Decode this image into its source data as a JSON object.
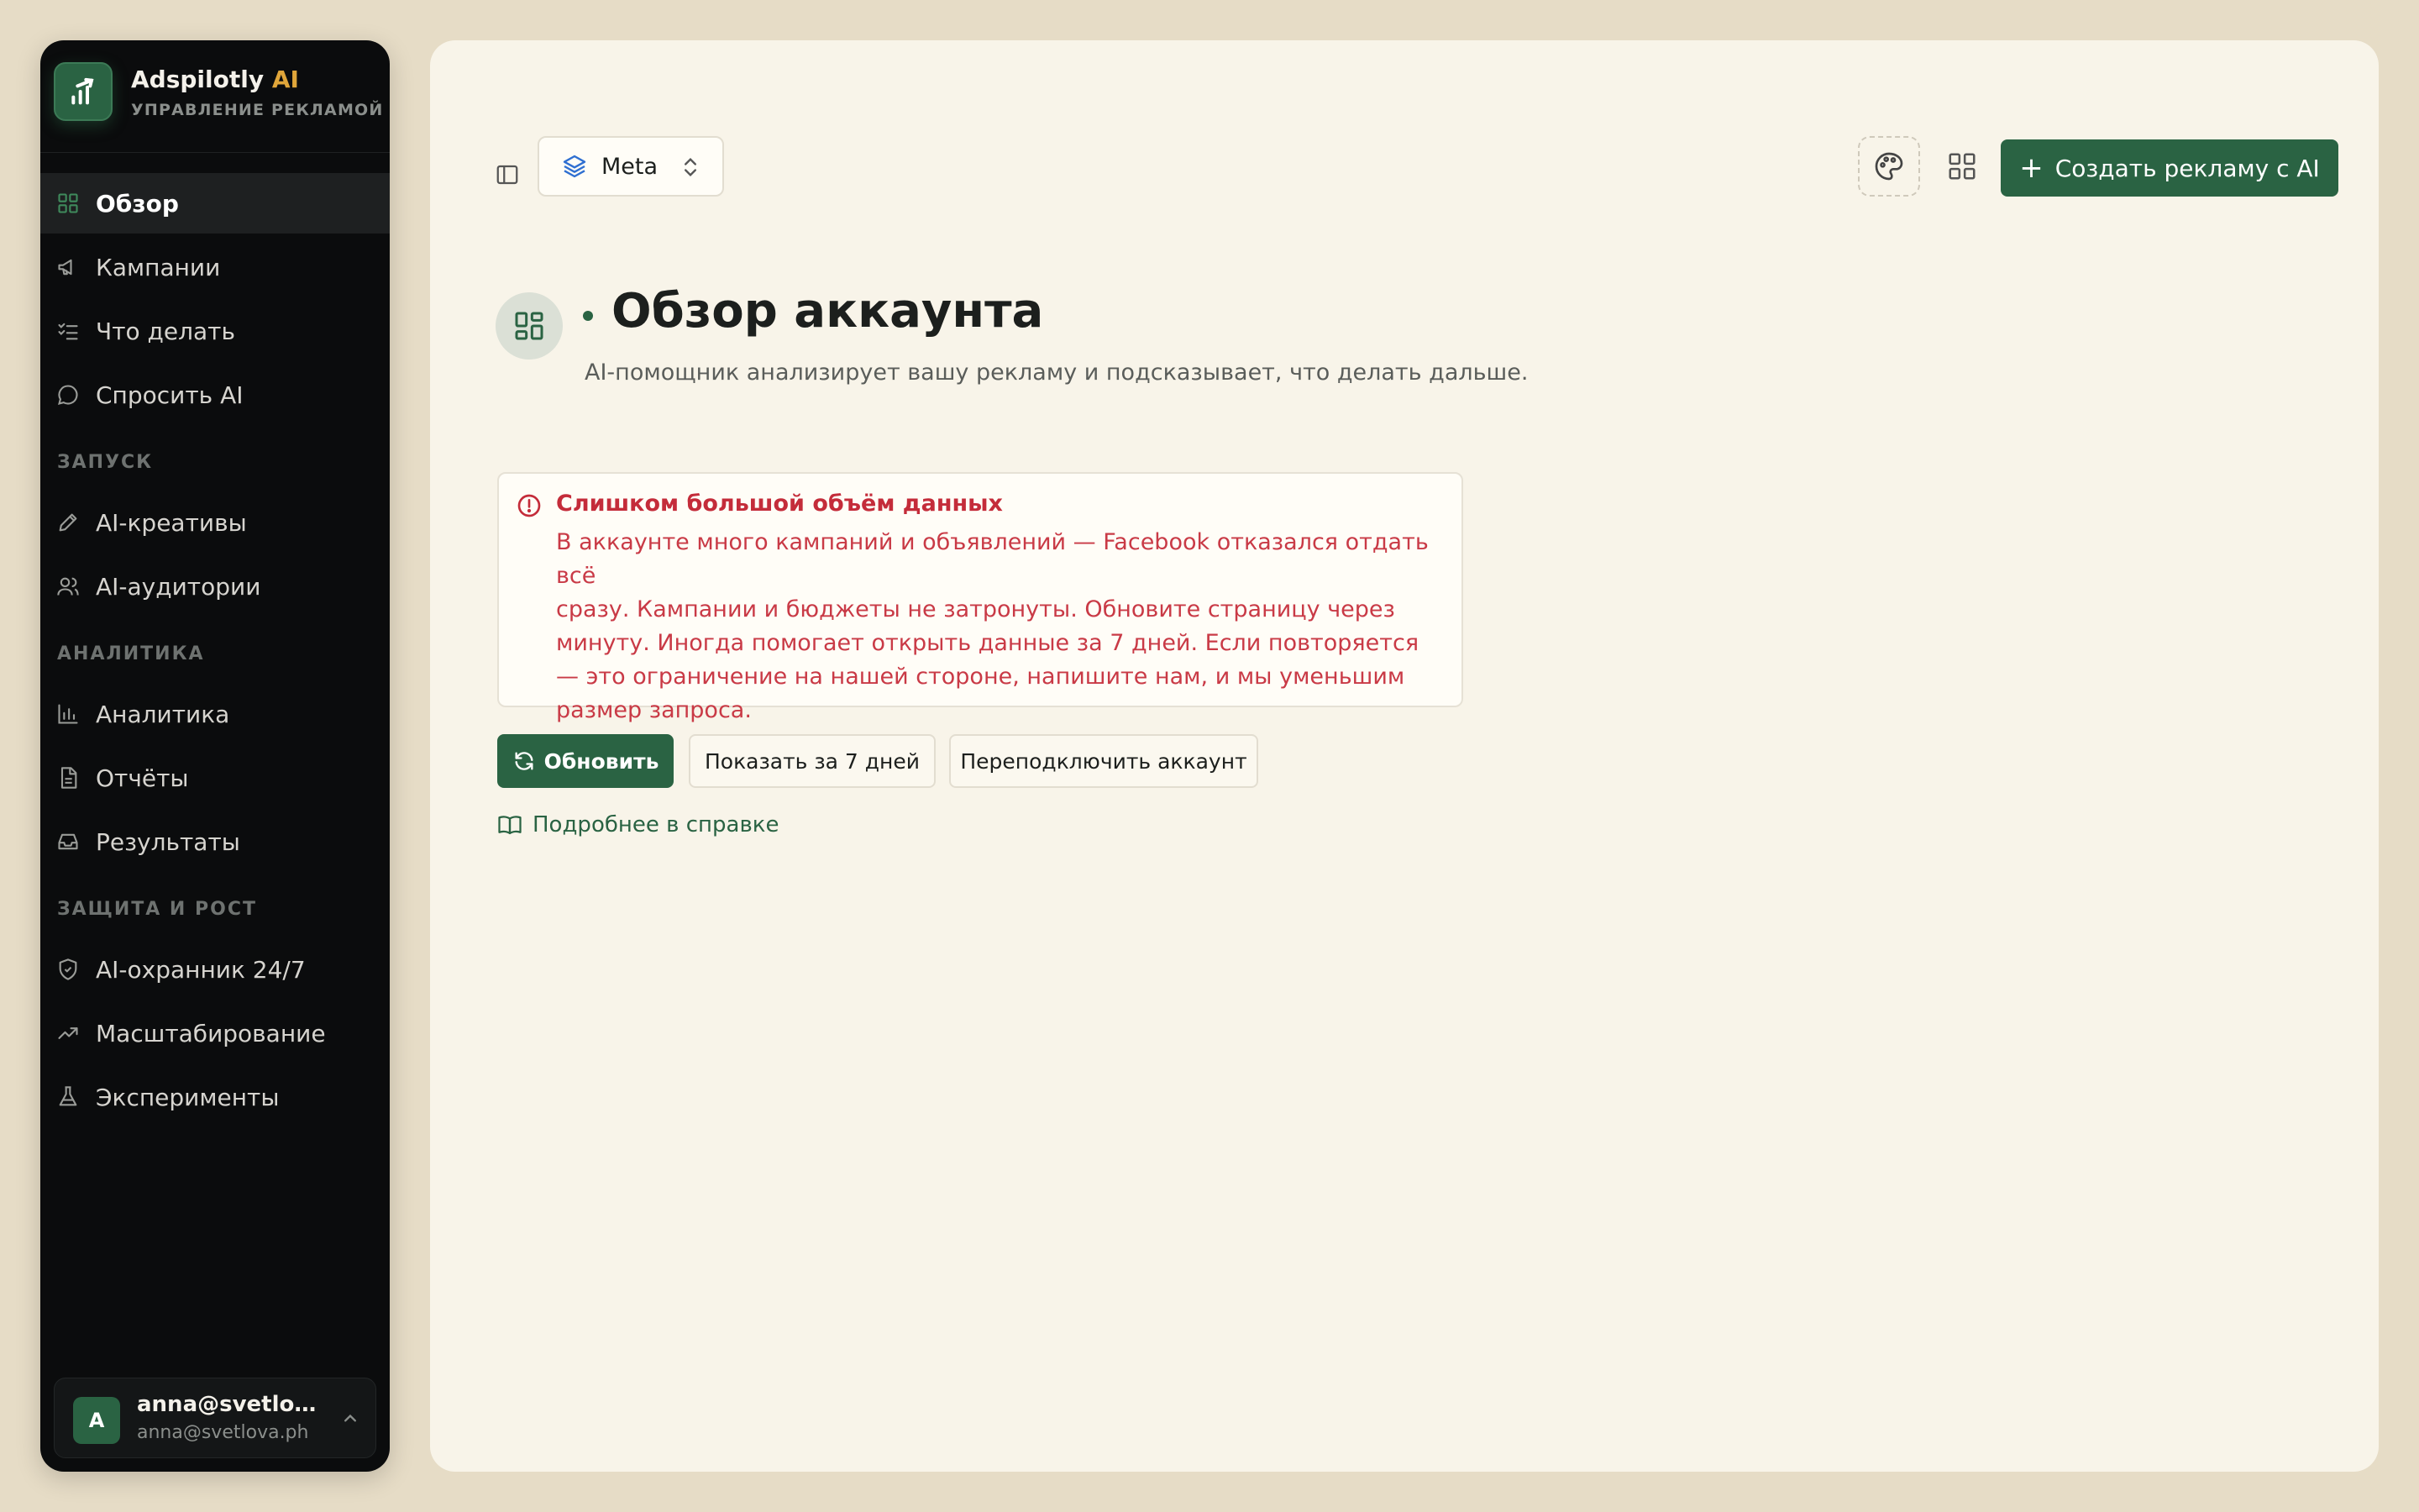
{
  "brand": {
    "name": "Adspilotly",
    "name_accent": "AI",
    "subtitle": "УПРАВЛЕНИЕ РЕКЛАМОЙ",
    "accent_color": "#e0a63a"
  },
  "nav": {
    "main": [
      {
        "label": "Обзор",
        "icon": "grid-icon",
        "active": true
      },
      {
        "label": "Кампании",
        "icon": "megaphone-icon"
      },
      {
        "label": "Что делать",
        "icon": "checklist-icon"
      },
      {
        "label": "Спросить AI",
        "icon": "chat-icon"
      }
    ],
    "sections": [
      {
        "title": "ЗАПУСК",
        "items": [
          {
            "label": "AI-креативы",
            "icon": "pen-icon"
          },
          {
            "label": "AI-аудитории",
            "icon": "users-icon"
          }
        ]
      },
      {
        "title": "АНАЛИТИКА",
        "items": [
          {
            "label": "Аналитика",
            "icon": "bar-chart-icon"
          },
          {
            "label": "Отчёты",
            "icon": "document-icon"
          },
          {
            "label": "Результаты",
            "icon": "inbox-icon"
          }
        ]
      },
      {
        "title": "ЗАЩИТА И РОСТ",
        "items": [
          {
            "label": "AI-охранник 24/7",
            "icon": "shield-icon"
          },
          {
            "label": "Масштабирование",
            "icon": "trending-up-icon"
          },
          {
            "label": "Эксперименты",
            "icon": "flask-icon"
          }
        ]
      }
    ]
  },
  "user": {
    "initial": "A",
    "name": "anna@svetlova.ph",
    "email": "anna@svetlova.ph"
  },
  "toolbar": {
    "platform": "Meta",
    "create_label": "Создать рекламу с AI"
  },
  "page": {
    "title": "Обзор аккаунта",
    "subtitle": "AI-помощник анализирует вашу рекламу и подсказывает, что делать дальше."
  },
  "alert": {
    "title": "Слишком большой объём данных",
    "body": "В аккаунте много кампаний и объявлений — Facebook отказался отдать всё\nсразу. Кампании и бюджеты не затронуты. Обновите страницу через\nминуту. Иногда помогает открыть данные за 7 дней. Если повторяется\n— это ограничение на нашей стороне, напишите нам, и мы уменьшим\nразмер запроса."
  },
  "actions": {
    "refresh": "Обновить",
    "show_7_days": "Показать за 7 дней",
    "reconnect": "Переподключить аккаунт",
    "help": "Подробнее в справке"
  },
  "colors": {
    "primary": "#2a6343",
    "error": "#c42c3a",
    "background": "#f8f4e9",
    "sidebar": "#0b0c0d"
  }
}
